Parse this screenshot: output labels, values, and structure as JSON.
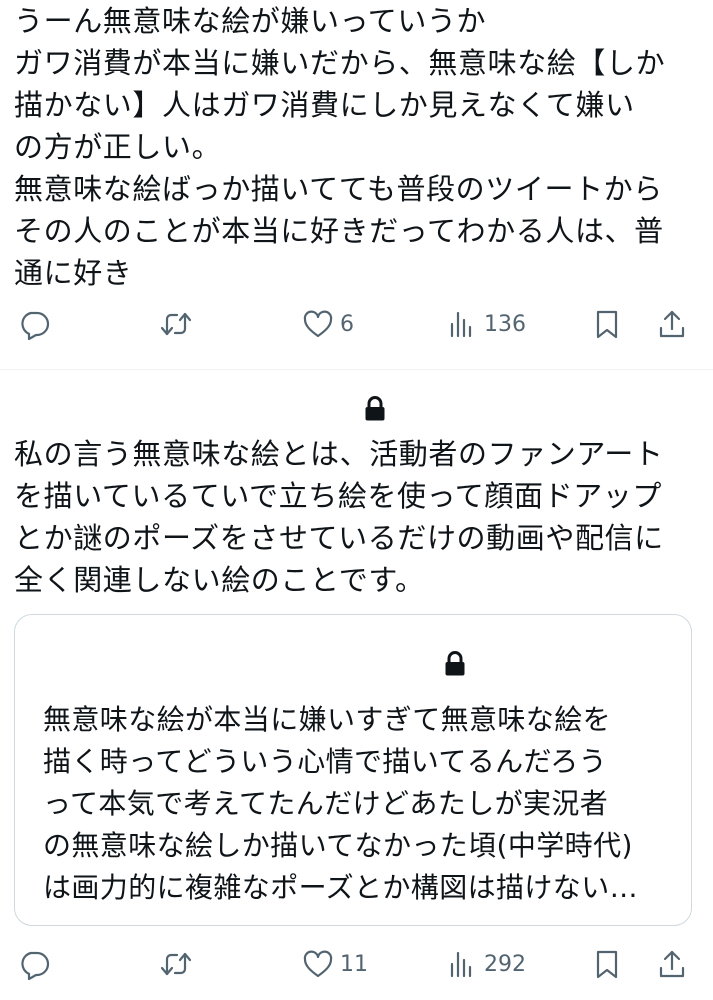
{
  "tweet1": {
    "text": "うーん無意味な絵が嫌いっていうか\nガワ消費が本当に嫌いだから、無意味な絵【しか\n描かない】人はガワ消費にしか見えなくて嫌い\nの方が正しい。\n無意味な絵ばっか描いてても普段のツイートから\nその人のことが本当に好きだってわかる人は、普\n通に好き",
    "actions": {
      "reply_icon": "speech-bubble-icon",
      "retweet_icon": "retweet-icon",
      "like_icon": "heart-icon",
      "like_count": "6",
      "views_icon": "bar-chart-icon",
      "views_count": "136",
      "bookmark_icon": "bookmark-icon",
      "share_icon": "share-icon"
    }
  },
  "tweet2": {
    "lock_icon": "lock-icon",
    "text": "私の言う無意味な絵とは、活動者のファンアート\nを描いているていで立ち絵を使って顔面ドアップ\nとか謎のポーズをさせているだけの動画や配信に\n全く関連しない絵のことです。",
    "quote": {
      "lock_icon": "lock-icon",
      "text": "無意味な絵が本当に嫌いすぎて無意味な絵を\n描く時ってどういう心情で描いてるんだろう\nって本気で考えてたんだけどあたしが実況者\nの無意味な絵しか描いてなかった頃(中学時代)\nは画力的に複雑なポーズとか構図は描けない…"
    },
    "actions": {
      "reply_icon": "speech-bubble-icon",
      "retweet_icon": "retweet-icon",
      "like_icon": "heart-icon",
      "like_count": "11",
      "views_icon": "bar-chart-icon",
      "views_count": "292",
      "bookmark_icon": "bookmark-icon",
      "share_icon": "share-icon"
    }
  },
  "colors": {
    "text": "#0f1419",
    "secondary": "#536471",
    "border": "#cfd9de",
    "divider": "#eff3f4",
    "lock": "#0f1419"
  }
}
